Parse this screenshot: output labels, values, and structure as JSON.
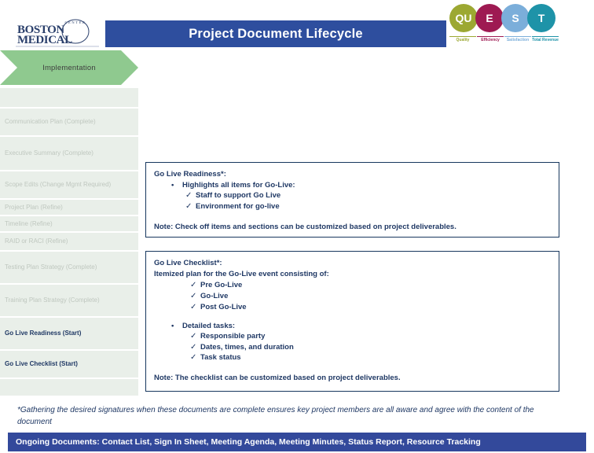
{
  "header": {
    "logo": {
      "line1": "BOSTON",
      "line2": "MEDICAL",
      "arc": "CENTER"
    },
    "title": "Project Document Lifecycle",
    "quest": {
      "circles": [
        {
          "letter": "QU",
          "color": "#9CA832"
        },
        {
          "letter": "E",
          "color": "#9E1A52"
        },
        {
          "letter": "S",
          "color": "#7BAEDA"
        },
        {
          "letter": "T",
          "color": "#1E93A8"
        }
      ],
      "labels": [
        {
          "text": "Quality",
          "color": "#9CA832"
        },
        {
          "text": "Efficiency",
          "color": "#9E1A52"
        },
        {
          "text": "Satisfaction",
          "color": "#7BAEDA"
        },
        {
          "text": "Total Revenue",
          "color": "#1E93A8"
        }
      ]
    }
  },
  "sidebar": {
    "phase": "Implementation",
    "phase_color": "#8FC98F",
    "items": [
      {
        "label": "",
        "state": "muted",
        "height": 26
      },
      {
        "label": "Communication Plan (Complete)",
        "state": "muted",
        "height": 36
      },
      {
        "label": "Executive Summary (Complete)",
        "state": "muted",
        "height": 44
      },
      {
        "label": "Scope Edits (Change Mgmt Required)",
        "state": "muted",
        "height": 36
      },
      {
        "label": "Project Plan (Refine)",
        "state": "muted",
        "height": 21
      },
      {
        "label": "Timeline (Refine)",
        "state": "muted",
        "height": 21
      },
      {
        "label": "RAID or RACI (Refine)",
        "state": "muted",
        "height": 24
      },
      {
        "label": "Testing Plan Strategy (Complete)",
        "state": "muted",
        "height": 42
      },
      {
        "label": "Training Plan Strategy (Complete)",
        "state": "muted",
        "height": 42
      },
      {
        "label": "Go Live Readiness (Start)",
        "state": "active",
        "height": 42
      },
      {
        "label": "Go Live Checklist (Start)",
        "state": "active",
        "height": 36
      },
      {
        "label": "",
        "state": "muted",
        "height": 23
      }
    ]
  },
  "boxes": {
    "readiness": {
      "heading": "Go Live Readiness*:",
      "bullet": "Highlights all items for Go-Live:",
      "bullet_marker": "•",
      "checks": [
        "Staff to support Go Live",
        "Environment for go-live"
      ],
      "check_marker": "✓",
      "note": "Note:  Check off items and sections can be customized based on project deliverables."
    },
    "checklist": {
      "heading": "Go Live Checklist*:",
      "subheading": "Itemized plan for the Go-Live event consisting of:",
      "checks_1": [
        "Pre Go-Live",
        "Go-Live",
        "Post Go-Live"
      ],
      "bullet": "Detailed tasks:",
      "bullet_marker": "•",
      "sub_bullet_marker": "▪",
      "checks_2": [
        "Responsible party",
        "Dates, times, and duration",
        "Task status"
      ],
      "check_marker": "✓",
      "note": "Note: The checklist can be customized based on project deliverables."
    }
  },
  "footnote": "*Gathering the desired signatures when these documents are complete ensures  key project members are all aware and agree with the content of the document",
  "ongoing_banner": {
    "text": "Ongoing Documents:  Contact List, Sign In Sheet, Meeting Agenda, Meeting Minutes, Status Report, Resource Tracking",
    "color": "#33499B"
  }
}
